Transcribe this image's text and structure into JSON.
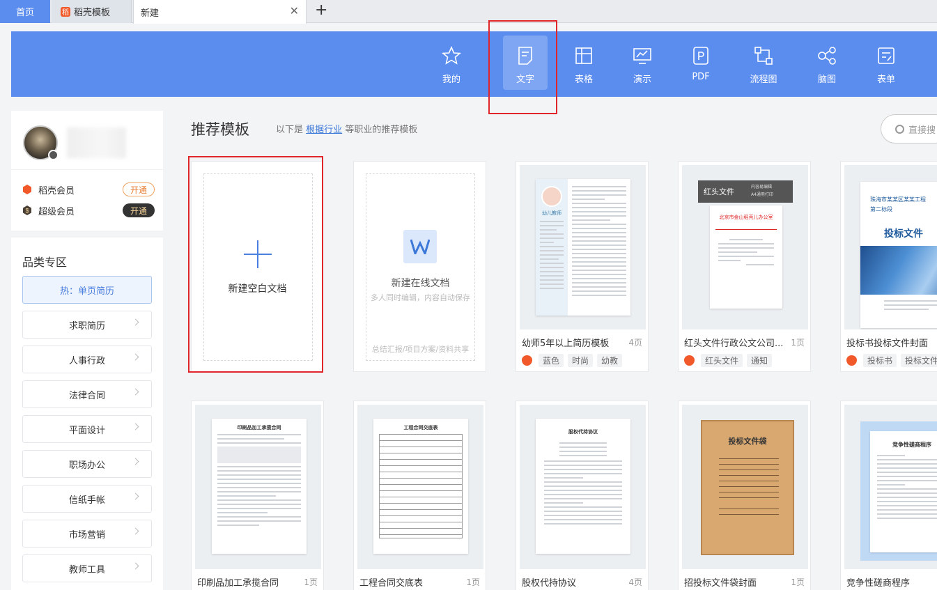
{
  "tabs": {
    "home": "首页",
    "template": "稻壳模板",
    "new": "新建",
    "close_icon": "close-icon",
    "add_icon": "plus-icon"
  },
  "nav": {
    "items": [
      {
        "label": "我的",
        "icon": "star-icon"
      },
      {
        "label": "文字",
        "icon": "document-icon",
        "active": true
      },
      {
        "label": "表格",
        "icon": "table-icon"
      },
      {
        "label": "演示",
        "icon": "presentation-icon"
      },
      {
        "label": "PDF",
        "icon": "pdf-icon"
      },
      {
        "label": "流程图",
        "icon": "flowchart-icon"
      },
      {
        "label": "脑图",
        "icon": "mindmap-icon"
      },
      {
        "label": "表单",
        "icon": "form-icon"
      }
    ]
  },
  "user": {
    "members": [
      {
        "label": "稻壳会员",
        "button": "开通",
        "style": "outline"
      },
      {
        "label": "超级会员",
        "button": "开通",
        "style": "dark"
      }
    ]
  },
  "categories": {
    "title": "品类专区",
    "hot": "热：单页简历",
    "items": [
      "求职简历",
      "人事行政",
      "法律合同",
      "平面设计",
      "职场办公",
      "信纸手帐",
      "市场营销",
      "教师工具"
    ]
  },
  "main": {
    "title": "推荐模板",
    "subtitle_prefix": "以下是",
    "subtitle_link": "根据行业",
    "subtitle_suffix": "等职业的推荐模板",
    "search_placeholder": "直接搜"
  },
  "new_cards": {
    "blank": {
      "label": "新建空白文档"
    },
    "online": {
      "label": "新建在线文档",
      "desc": "多人同时编辑，内容自动保存",
      "footer": "总结汇报/项目方案/资料共享"
    }
  },
  "templates_row1": [
    {
      "title": "幼师5年以上简历模板",
      "pages": "4页",
      "tags": [
        "蓝色",
        "时尚",
        "幼教"
      ],
      "thumb": {
        "name": "幼儿教师"
      }
    },
    {
      "title": "红头文件行政公文公司...",
      "pages": "1页",
      "tags": [
        "红头文件",
        "通知"
      ],
      "thumb": {
        "header": "红头文件",
        "side": "内容易编辑",
        "side2": "A4通用打印",
        "org": "北京市金山稻壳儿办公室"
      }
    },
    {
      "title": "投标书投标文件封面",
      "pages": "",
      "tags": [
        "投标书",
        "投标文件"
      ],
      "thumb": {
        "line1": "珠海市某某区某某工程",
        "line2": "第二标段",
        "big": "投标文件"
      }
    }
  ],
  "templates_row2": [
    {
      "title": "印刷品加工承揽合同",
      "pages": "1页",
      "thumb": {
        "head": "印刷品加工承揽合同"
      }
    },
    {
      "title": "工程合同交底表",
      "pages": "1页",
      "thumb": {
        "head": "工程合同交底表"
      }
    },
    {
      "title": "股权代持协议",
      "pages": "4页",
      "thumb": {
        "head": "股权代持协议"
      }
    },
    {
      "title": "招投标文件袋封面",
      "pages": "1页",
      "thumb": {
        "head": "投标文件袋"
      }
    },
    {
      "title": "竞争性磋商程序",
      "pages": "",
      "thumb": {
        "head": "竞争性磋商程序"
      }
    }
  ]
}
